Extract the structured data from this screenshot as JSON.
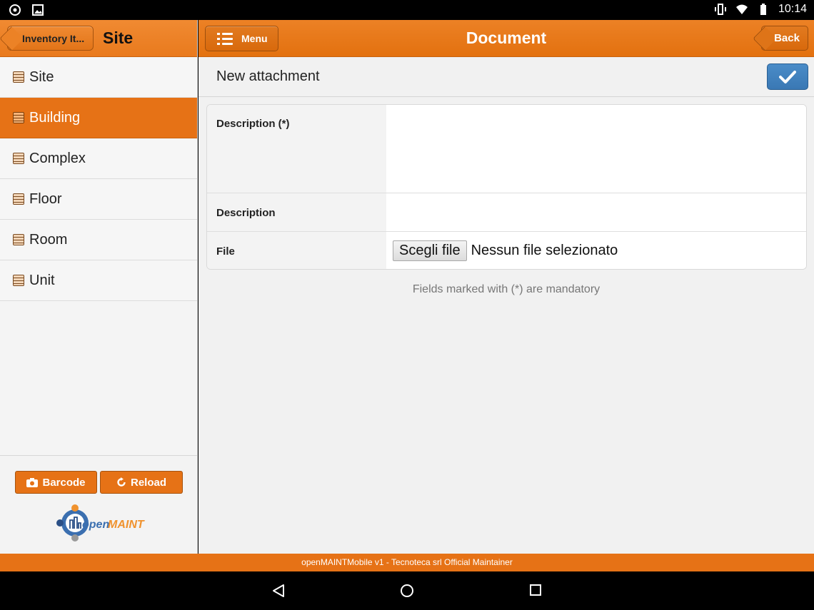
{
  "status_bar": {
    "time": "10:14"
  },
  "left_panel": {
    "back_label": "Inventory It...",
    "title": "Site",
    "items": [
      {
        "label": "Site"
      },
      {
        "label": "Building"
      },
      {
        "label": "Complex"
      },
      {
        "label": "Floor"
      },
      {
        "label": "Room"
      },
      {
        "label": "Unit"
      }
    ],
    "barcode_label": "Barcode",
    "reload_label": "Reload",
    "logo_text_open": "open",
    "logo_text_maint": "MAINT"
  },
  "header": {
    "menu_label": "Menu",
    "title": "Document",
    "back_label": "Back"
  },
  "subheader": {
    "title": "New attachment"
  },
  "form": {
    "fields": [
      {
        "label": "Description (*)",
        "value": ""
      },
      {
        "label": "Description",
        "value": ""
      },
      {
        "label": "File",
        "button_label": "Scegli file",
        "status": "Nessun file selezionato"
      }
    ],
    "mandatory_note": "Fields marked with (*) are mandatory"
  },
  "footer": {
    "text": "openMAINTMobile v1 - Tecnoteca srl Official Maintainer"
  },
  "colors": {
    "accent": "#e67216",
    "confirm": "#3f7fbd"
  }
}
